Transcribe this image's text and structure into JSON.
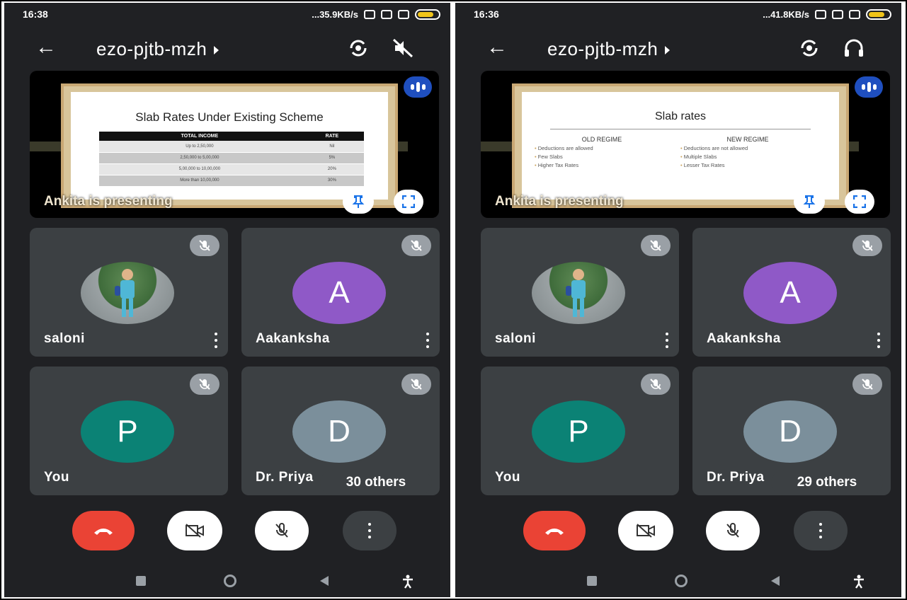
{
  "screens": [
    {
      "status": {
        "time": "16:38",
        "net": "...35.9KB/s"
      },
      "meeting_code": "ezo-pjtb-mzh",
      "presentation": {
        "presenter_text": "Ankita is presenting",
        "slide_title": "Slab Rates Under Existing Scheme",
        "table": {
          "headers": [
            "TOTAL INCOME",
            "RATE"
          ],
          "rows": [
            [
              "Up to 2,50,000",
              "Nil"
            ],
            [
              "2,50,000 to 5,00,000",
              "5%"
            ],
            [
              "5,00,000 to 10,00,000",
              "20%"
            ],
            [
              "More than 10,00,000",
              "30%"
            ]
          ]
        }
      },
      "participants": [
        {
          "name": "saloni",
          "avatar": "photo"
        },
        {
          "name": "Aakanksha",
          "initial": "A"
        },
        {
          "name": "You",
          "initial": "P"
        },
        {
          "name": "Dr. Priya",
          "initial": "D"
        }
      ],
      "others_label": "30 others",
      "header_right_icon": "speaker-off-icon"
    },
    {
      "status": {
        "time": "16:36",
        "net": "...41.8KB/s"
      },
      "meeting_code": "ezo-pjtb-mzh",
      "presentation": {
        "presenter_text": "Ankita is presenting",
        "slide_title": "Slab rates",
        "columns": [
          {
            "heading": "OLD REGIME",
            "items": [
              "Deductions are allowed",
              "Few Slabs",
              "Higher Tax Rates"
            ]
          },
          {
            "heading": "NEW REGIME",
            "items": [
              "Deductions are not allowed",
              "Multiple Slabs",
              "Lesser Tax Rates"
            ]
          }
        ]
      },
      "participants": [
        {
          "name": "saloni",
          "avatar": "photo"
        },
        {
          "name": "Aakanksha",
          "initial": "A"
        },
        {
          "name": "You",
          "initial": "P"
        },
        {
          "name": "Dr. Priya",
          "initial": "D"
        }
      ],
      "others_label": "29 others",
      "header_right_icon": "headphones-icon"
    }
  ],
  "colors": {
    "background": "#202124",
    "tile": "#3c4043",
    "end_call": "#ea4335",
    "avatar_a": "#8f59c7",
    "avatar_p": "#0b8275",
    "avatar_d": "#7b8f9b",
    "presenting_badge": "#1f4fbf"
  }
}
